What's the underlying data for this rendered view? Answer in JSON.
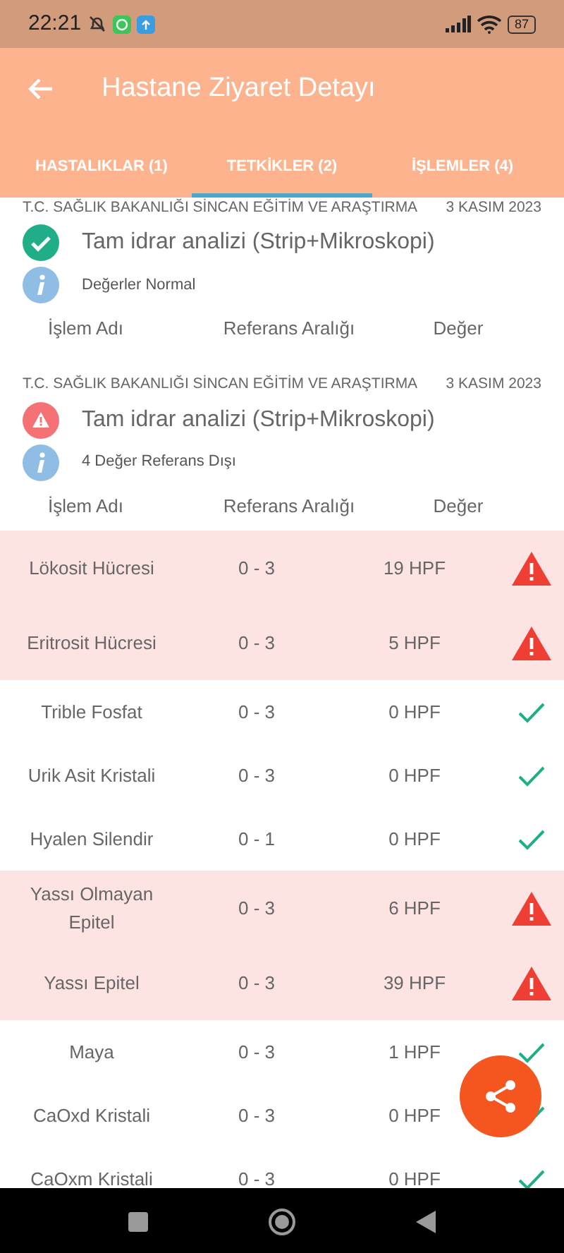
{
  "status_bar": {
    "time": "22:21",
    "battery": "87"
  },
  "app_bar": {
    "title": "Hastane Ziyaret Detayı"
  },
  "tabs": [
    {
      "label": "HASTALIKLAR (1)",
      "selected": false
    },
    {
      "label": "TETKİKLER (2)",
      "selected": true
    },
    {
      "label": "İŞLEMLER (4)",
      "selected": false
    }
  ],
  "records": [
    {
      "institution": "T.C. SAĞLIK BAKANLIĞI SİNCAN EĞİTİM VE ARAŞTIRMA",
      "date": "3 KASIM 2023",
      "test": "Tam idrar analizi (Strip+Mikroskopi)",
      "kind": "ok",
      "note": "Değerler Normal",
      "columns": [
        "İşlem Adı",
        "Referans Aralığı",
        "Değer"
      ]
    },
    {
      "institution": "T.C. SAĞLIK BAKANLIĞI SİNCAN EĞİTİM VE ARAŞTIRMA",
      "date": "3 KASIM 2023",
      "test": "Tam idrar analizi (Strip+Mikroskopi)",
      "kind": "warning",
      "note": "4 Değer Referans Dışı",
      "columns": [
        "İşlem Adı",
        "Referans Aralığı",
        "Değer"
      ],
      "rows": [
        {
          "name": "Lökosit Hücresi",
          "range": "0 - 3",
          "value": "19 HPF",
          "abnormal": true
        },
        {
          "name": "Eritrosit Hücresi",
          "range": "0 - 3",
          "value": "5 HPF",
          "abnormal": true
        },
        {
          "name": "Trible Fosfat",
          "range": "0 - 3",
          "value": "0 HPF",
          "abnormal": false
        },
        {
          "name": "Urik Asit Kristali",
          "range": "0 - 3",
          "value": "0 HPF",
          "abnormal": false
        },
        {
          "name": "Hyalen Silendir",
          "range": "0 - 1",
          "value": "0 HPF",
          "abnormal": false
        },
        {
          "name": "Yassı Olmayan Epitel",
          "range": "0 - 3",
          "value": "6 HPF",
          "abnormal": true
        },
        {
          "name": "Yassı Epitel",
          "range": "0 - 3",
          "value": "39 HPF",
          "abnormal": true
        },
        {
          "name": "Maya",
          "range": "0 - 3",
          "value": "1 HPF",
          "abnormal": false
        },
        {
          "name": "CaOxd Kristali",
          "range": "0 - 3",
          "value": "0 HPF",
          "abnormal": false
        },
        {
          "name": "CaOxm Kristali",
          "range": "0 - 3",
          "value": "0 HPF",
          "abnormal": false
        }
      ]
    }
  ]
}
